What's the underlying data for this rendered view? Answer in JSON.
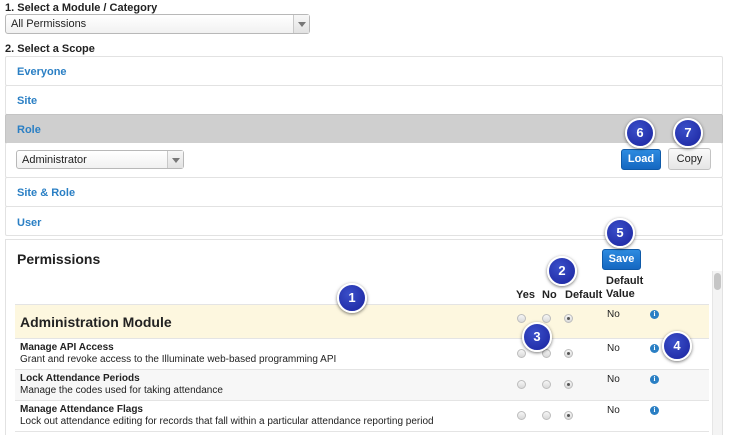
{
  "step1": {
    "label": "1. Select a Module / Category",
    "selected": "All Permissions"
  },
  "step2": {
    "label": "2. Select a Scope"
  },
  "scopes": [
    "Everyone",
    "Site",
    "Role",
    "Site & Role",
    "User"
  ],
  "role_select": "Administrator",
  "buttons": {
    "load": "Load",
    "copy": "Copy",
    "save": "Save"
  },
  "permissions": {
    "heading": "Permissions",
    "columns": {
      "yes": "Yes",
      "no": "No",
      "default": "Default",
      "default_value": "Default\nValue"
    },
    "module": {
      "title": "Administration Module",
      "value": "No"
    },
    "rows": [
      {
        "title": "Manage API Access",
        "desc": "Grant and revoke access to the Illuminate web-based programming API",
        "value": "No"
      },
      {
        "title": "Lock Attendance Periods",
        "desc": "Manage the codes used for taking attendance",
        "value": "No"
      },
      {
        "title": "Manage Attendance Flags",
        "desc": "Lock out attendance editing for records that fall within a particular attendance reporting period",
        "value": "No"
      }
    ]
  },
  "callouts": [
    "1",
    "2",
    "3",
    "4",
    "5",
    "6",
    "7"
  ],
  "colors": {
    "link": "#2a7fc4",
    "primary": "#1567c1",
    "module_row": "#fdf7df",
    "badge": "#1a239e"
  }
}
